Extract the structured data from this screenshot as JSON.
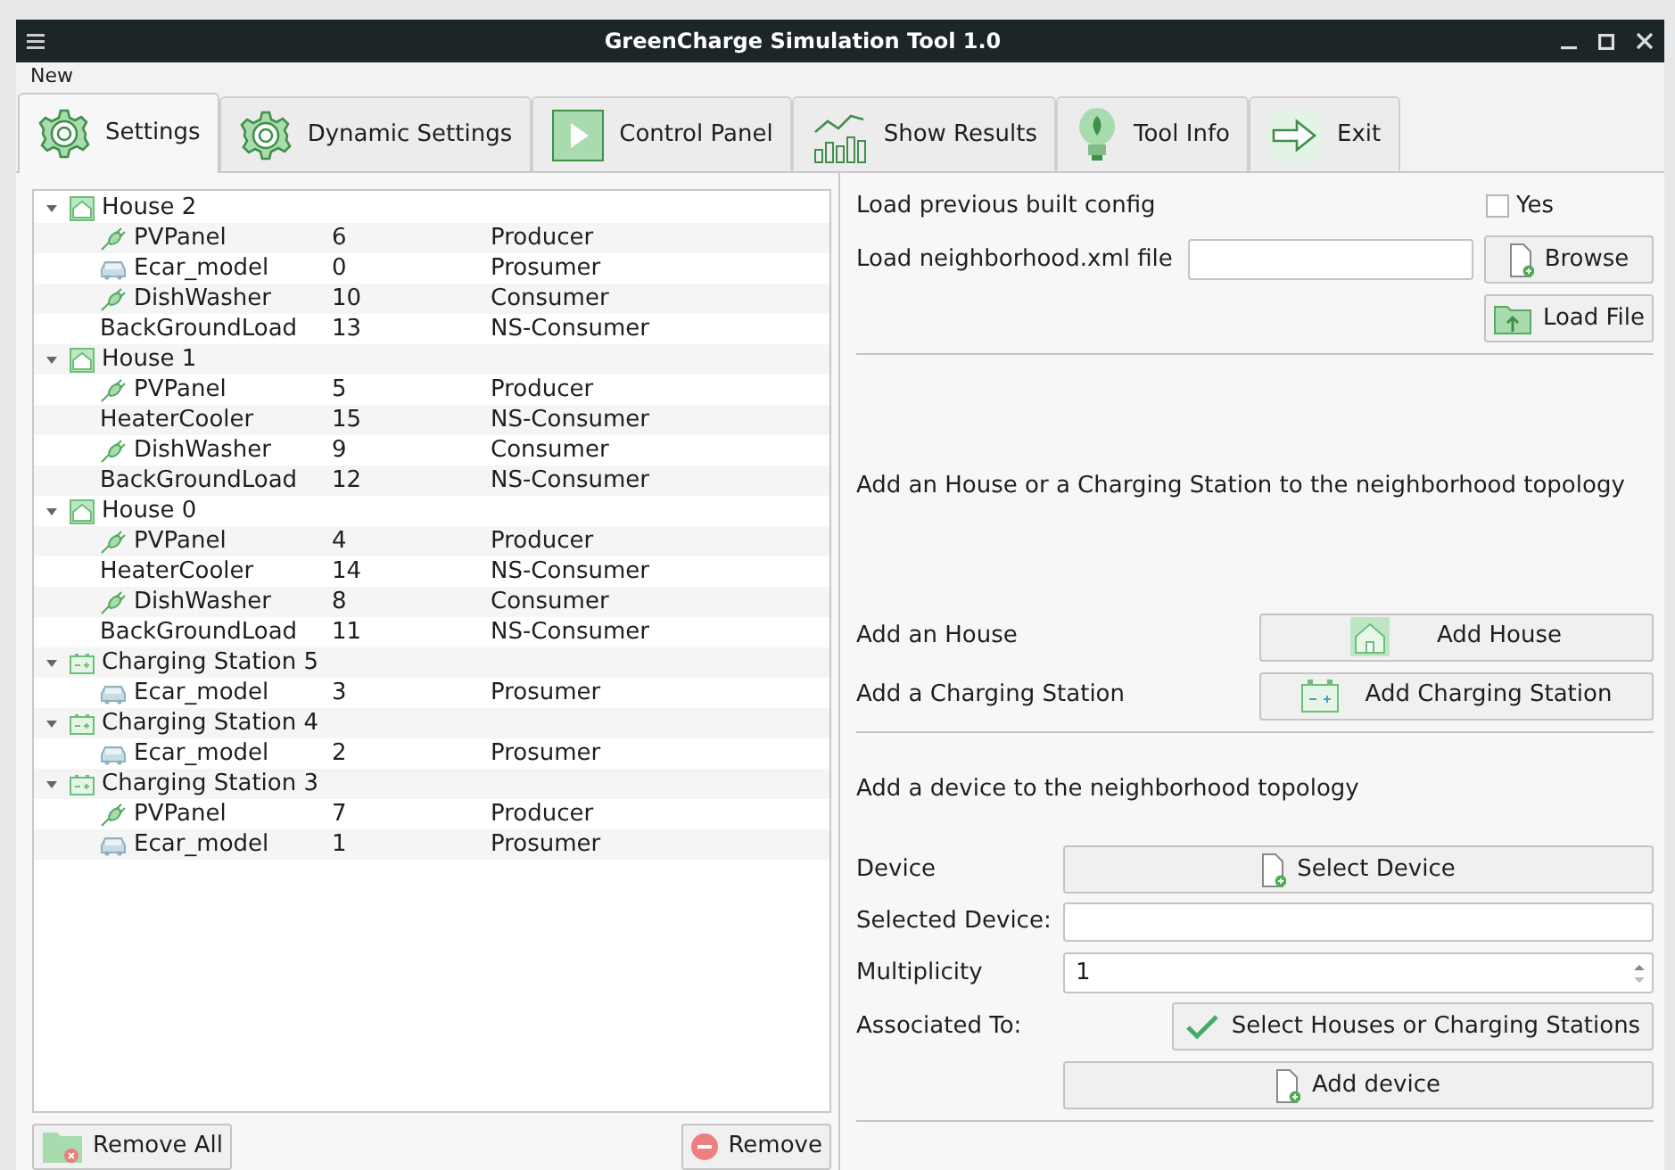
{
  "window": {
    "title": "GreenCharge Simulation Tool 1.0"
  },
  "menu": [
    "New"
  ],
  "tabs": [
    {
      "label": "Settings",
      "selected": true
    },
    {
      "label": "Dynamic Settings",
      "selected": false
    },
    {
      "label": "Control Panel",
      "selected": false
    },
    {
      "label": "Show Results",
      "selected": false
    },
    {
      "label": "Tool Info",
      "selected": false
    },
    {
      "label": "Exit",
      "selected": false
    }
  ],
  "tree": [
    {
      "name": "House 2",
      "kind": "house",
      "expanded": true,
      "children": [
        {
          "name": "PVPanel",
          "kind": "plug",
          "id": "6",
          "type": "Producer"
        },
        {
          "name": "Ecar_model",
          "kind": "car",
          "id": "0",
          "type": "Prosumer"
        },
        {
          "name": "DishWasher",
          "kind": "plug",
          "id": "10",
          "type": "Consumer"
        },
        {
          "name": "BackGroundLoad",
          "kind": "plain",
          "id": "13",
          "type": "NS-Consumer"
        }
      ]
    },
    {
      "name": "House 1",
      "kind": "house",
      "expanded": true,
      "children": [
        {
          "name": "PVPanel",
          "kind": "plug",
          "id": "5",
          "type": "Producer"
        },
        {
          "name": "HeaterCooler",
          "kind": "plain",
          "id": "15",
          "type": "NS-Consumer"
        },
        {
          "name": "DishWasher",
          "kind": "plug",
          "id": "9",
          "type": "Consumer"
        },
        {
          "name": "BackGroundLoad",
          "kind": "plain",
          "id": "12",
          "type": "NS-Consumer"
        }
      ]
    },
    {
      "name": "House 0",
      "kind": "house",
      "expanded": true,
      "children": [
        {
          "name": "PVPanel",
          "kind": "plug",
          "id": "4",
          "type": "Producer"
        },
        {
          "name": "HeaterCooler",
          "kind": "plain",
          "id": "14",
          "type": "NS-Consumer"
        },
        {
          "name": "DishWasher",
          "kind": "plug",
          "id": "8",
          "type": "Consumer"
        },
        {
          "name": "BackGroundLoad",
          "kind": "plain",
          "id": "11",
          "type": "NS-Consumer"
        }
      ]
    },
    {
      "name": "Charging Station 5",
      "kind": "station",
      "expanded": true,
      "children": [
        {
          "name": "Ecar_model",
          "kind": "car",
          "id": "3",
          "type": "Prosumer"
        }
      ]
    },
    {
      "name": "Charging Station 4",
      "kind": "station",
      "expanded": true,
      "children": [
        {
          "name": "Ecar_model",
          "kind": "car",
          "id": "2",
          "type": "Prosumer"
        }
      ]
    },
    {
      "name": "Charging Station 3",
      "kind": "station",
      "expanded": true,
      "children": [
        {
          "name": "PVPanel",
          "kind": "plug",
          "id": "7",
          "type": "Producer"
        },
        {
          "name": "Ecar_model",
          "kind": "car",
          "id": "1",
          "type": "Prosumer"
        }
      ]
    }
  ],
  "tree_buttons": {
    "remove_all": "Remove All",
    "remove": "Remove"
  },
  "load": {
    "previous_label": "Load previous built config",
    "yes_label": "Yes",
    "yes_checked": false,
    "file_label": "Load neighborhood.xml file",
    "browse": "Browse",
    "load_file": "Load File"
  },
  "topology": {
    "heading": "Add an House or a Charging Station to the neighborhood topology",
    "house_label": "Add an House",
    "house_button": "Add House",
    "station_label": "Add a Charging Station",
    "station_button": "Add Charging Station"
  },
  "device": {
    "heading": "Add a device to the neighborhood topology",
    "device_label": "Device",
    "select_button": "Select Device",
    "selected_label": "Selected Device:",
    "multiplicity_label": "Multiplicity",
    "multiplicity": "1",
    "associated_label": "Associated To:",
    "associated_button": "Select Houses or Charging Stations",
    "add_button": "Add device"
  }
}
